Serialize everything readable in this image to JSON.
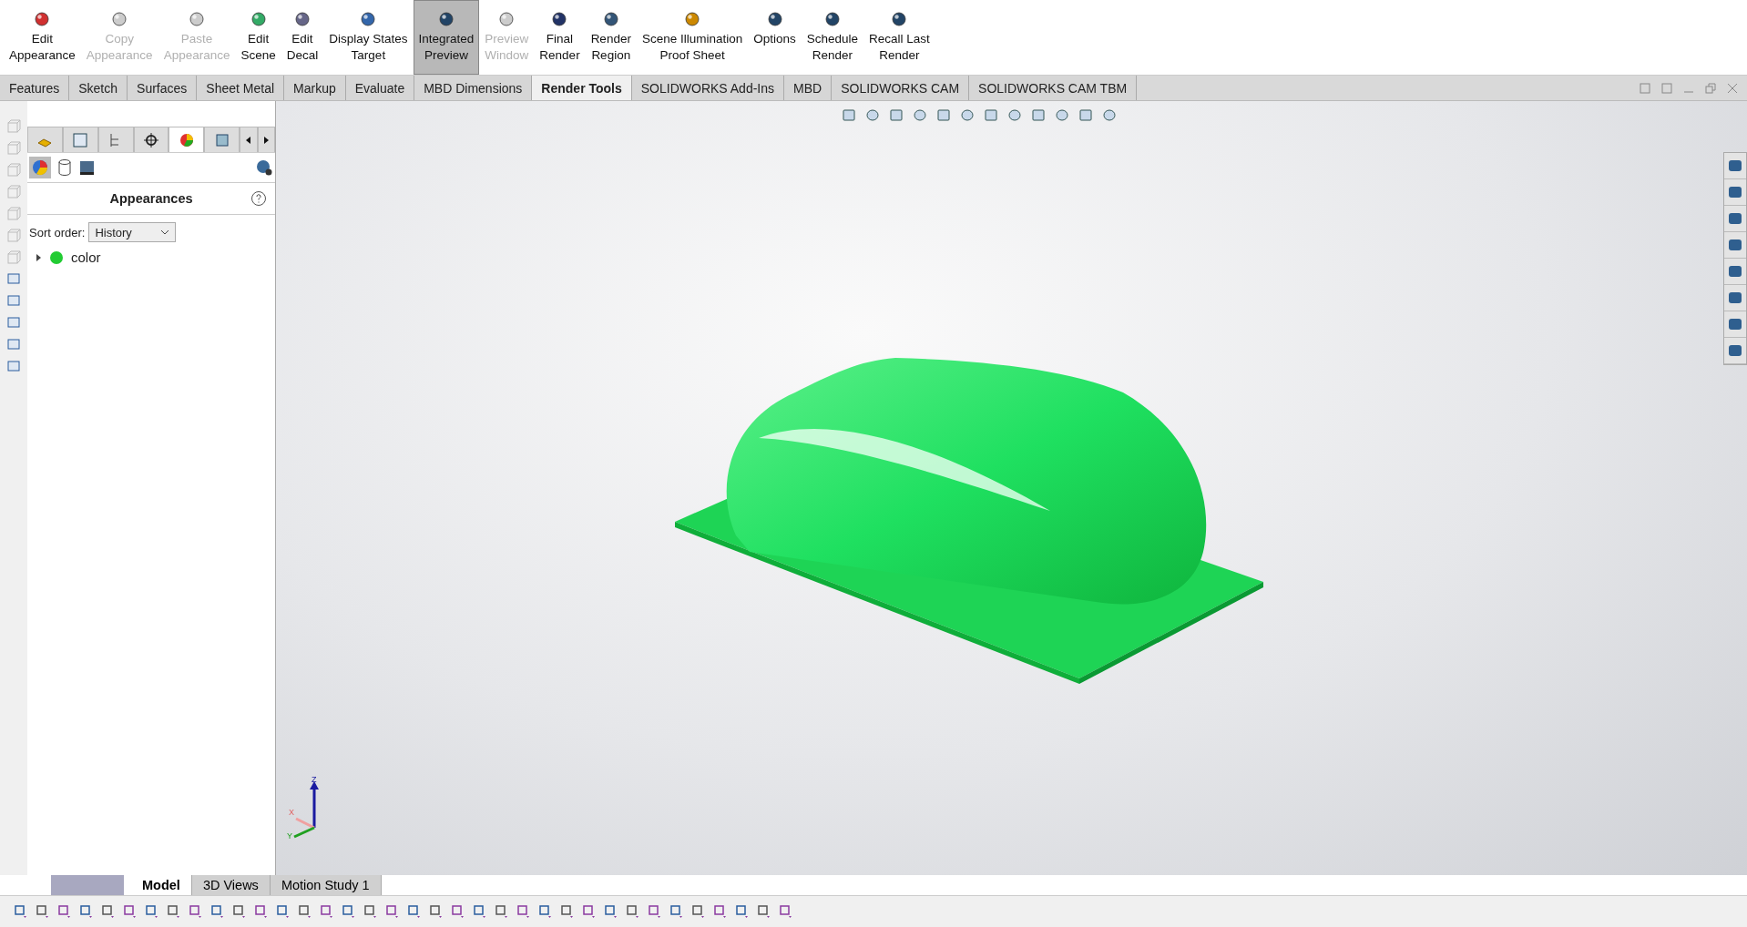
{
  "ribbon": [
    {
      "label": "Edit\nAppearance",
      "disabled": false,
      "selected": false
    },
    {
      "label": "Copy\nAppearance",
      "disabled": true,
      "selected": false
    },
    {
      "label": "Paste\nAppearance",
      "disabled": true,
      "selected": false
    },
    {
      "label": "Edit\nScene",
      "disabled": false,
      "selected": false
    },
    {
      "label": "Edit\nDecal",
      "disabled": false,
      "selected": false
    },
    {
      "label": "Display States\nTarget",
      "disabled": false,
      "selected": false
    },
    {
      "label": "Integrated\nPreview",
      "disabled": false,
      "selected": true
    },
    {
      "label": "Preview\nWindow",
      "disabled": true,
      "selected": false
    },
    {
      "label": "Final\nRender",
      "disabled": false,
      "selected": false
    },
    {
      "label": "Render\nRegion",
      "disabled": false,
      "selected": false
    },
    {
      "label": "Scene Illumination\nProof Sheet",
      "disabled": false,
      "selected": false
    },
    {
      "label": "Options",
      "disabled": false,
      "selected": false
    },
    {
      "label": "Schedule\nRender",
      "disabled": false,
      "selected": false
    },
    {
      "label": "Recall Last\nRender",
      "disabled": false,
      "selected": false
    }
  ],
  "tabs": [
    {
      "label": "Features",
      "selected": false
    },
    {
      "label": "Sketch",
      "selected": false
    },
    {
      "label": "Surfaces",
      "selected": false
    },
    {
      "label": "Sheet Metal",
      "selected": false
    },
    {
      "label": "Markup",
      "selected": false
    },
    {
      "label": "Evaluate",
      "selected": false
    },
    {
      "label": "MBD Dimensions",
      "selected": false
    },
    {
      "label": "Render Tools",
      "selected": true
    },
    {
      "label": "SOLIDWORKS Add-Ins",
      "selected": false
    },
    {
      "label": "MBD",
      "selected": false
    },
    {
      "label": "SOLIDWORKS CAM",
      "selected": false
    },
    {
      "label": "SOLIDWORKS CAM TBM",
      "selected": false
    }
  ],
  "panel": {
    "title": "Appearances",
    "sort_label": "Sort order:",
    "sort_value": "History",
    "tree": [
      {
        "label": "color",
        "color": "#22cc33",
        "expanded": false
      }
    ]
  },
  "triad": {
    "z": "Z",
    "x": "X",
    "y": "Y"
  },
  "bottom_tabs": [
    {
      "label": "Model",
      "selected": true
    },
    {
      "label": "3D Views",
      "selected": false
    },
    {
      "label": "Motion Study 1",
      "selected": false
    }
  ]
}
